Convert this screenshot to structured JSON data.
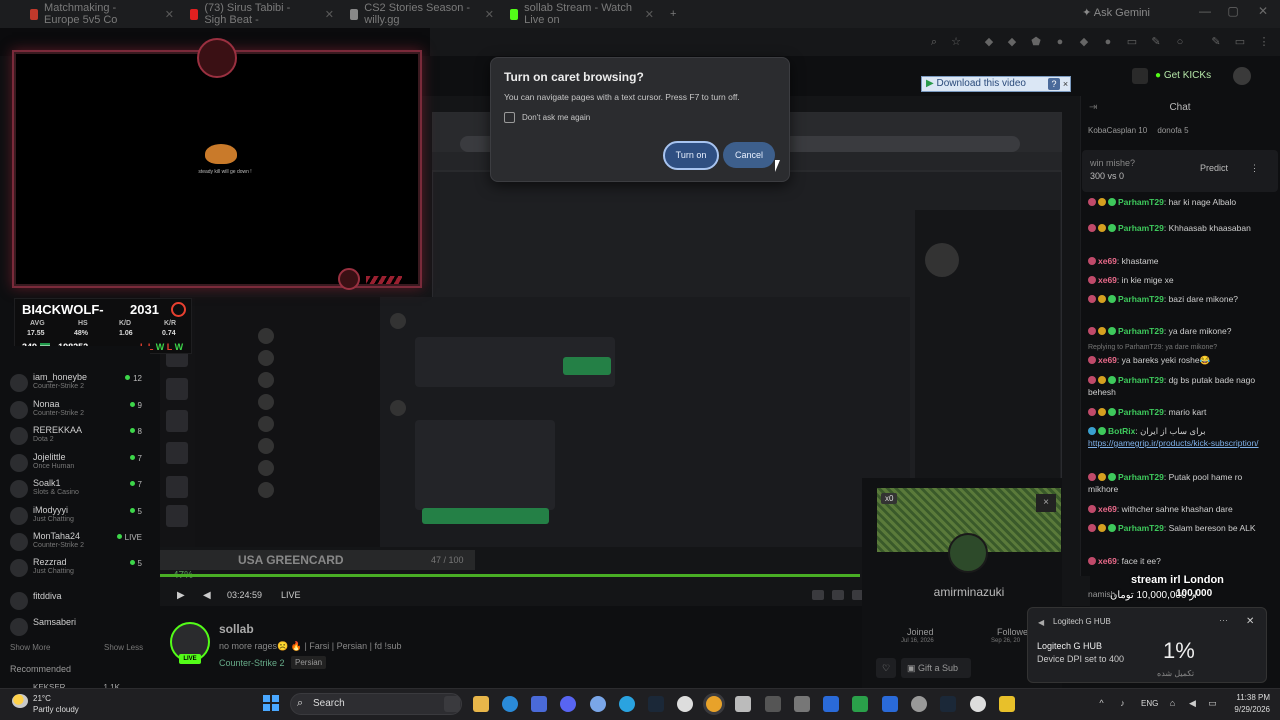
{
  "browser": {
    "tabs": [
      {
        "label": "Matchmaking - Europe 5v5 Co",
        "color": "#c0392b"
      },
      {
        "label": "(73) Sirus Tabibi - Sigh Beat -",
        "color": "#e02020"
      },
      {
        "label": "CS2 Stories Season - willy.gg",
        "color": "#888888"
      },
      {
        "label": "sollab Stream - Watch Live on",
        "color": "#53fc18"
      }
    ],
    "new_tab": "+",
    "ask_gemini": "Ask Gemini"
  },
  "dialog": {
    "title": "Turn on caret browsing?",
    "body": "You can navigate pages with a text cursor. Press F7 to turn off.",
    "checkbox_label": "Don't ask me again",
    "confirm": "Turn on",
    "cancel": "Cancel"
  },
  "download_bar": {
    "label": "Download this video",
    "help": "?",
    "close": "×"
  },
  "kick_header": {
    "get_kicks": "Get KICKs"
  },
  "stats_overlay": {
    "name": "BI4CKWOLF-",
    "elo": "2031",
    "headers": [
      "AVG",
      "HS",
      "K/D",
      "K/R"
    ],
    "values": [
      "17.55",
      "48%",
      "1.06",
      "0.74"
    ],
    "matches": "349",
    "points": "198252",
    "results": [
      "L",
      "L",
      "W",
      "L",
      "W"
    ]
  },
  "webcam": {
    "caption": "steady kill will ge down !"
  },
  "sidebar": {
    "channels": [
      {
        "name": "iam_honeybe",
        "game": "Counter-Strike 2",
        "viewers": "12"
      },
      {
        "name": "Nonaa",
        "game": "Counter-Strike 2",
        "viewers": "9"
      },
      {
        "name": "REREKKAA",
        "game": "Dota 2",
        "viewers": "8"
      },
      {
        "name": "Jojelittle",
        "game": "Once Human",
        "viewers": "7"
      },
      {
        "name": "Soalk1",
        "game": "Slots & Casino",
        "viewers": "7"
      },
      {
        "name": "iModyyyi",
        "game": "Just Chatting",
        "viewers": "5"
      },
      {
        "name": "MonTaha24",
        "game": "Counter-Strike 2",
        "viewers": "LIVE"
      },
      {
        "name": "Rezzrad",
        "game": "Just Chatting",
        "viewers": "5"
      },
      {
        "name": "fitddiva",
        "game": "",
        "viewers": ""
      },
      {
        "name": "Samsaberi",
        "game": "",
        "viewers": ""
      }
    ],
    "show_more": "Show More",
    "show_less": "Show Less",
    "recommended": "Recommended",
    "partial_item": "KEKSER",
    "partial_count": "1.1K"
  },
  "player": {
    "overlay_title": "USA GREENCARD",
    "overlay_count": "47 / 100",
    "overlay_pct": "47%",
    "progress": 1.0,
    "time": "03:24:59",
    "live": "LIVE"
  },
  "stream": {
    "streamer": "sollab",
    "title": "no more rages☹️ 🔥 | Farsi | Persian | fd !sub",
    "category": "Counter-Strike 2",
    "language": "Persian",
    "live_badge": "LIVE"
  },
  "sub_card": {
    "x_label": "x0",
    "name": "amirminazuki",
    "joined_label": "Joined",
    "joined_date": "Jul 16, 2026",
    "follow_label": "Followe",
    "follow_date": "Sep 26, 20",
    "gift": "Gift a Sub",
    "close": "×"
  },
  "chat": {
    "title": "Chat",
    "users": [
      "KobaCasplan 10",
      "donofa 5"
    ],
    "prediction_q": "win mishe?",
    "prediction_odds": "300 vs 0",
    "predict": "Predict",
    "messages": [
      {
        "user": "ParhamT29",
        "color": "#3ec95c",
        "text": "har ki nage Albalo"
      },
      {
        "user": "ParhamT29",
        "color": "#3ec95c",
        "text": "Khhaasab khaasaban"
      },
      {
        "user": "xe69",
        "color": "#e86a8a",
        "text": "khastame"
      },
      {
        "user": "xe69",
        "color": "#e86a8a",
        "text": "in kie mige xe"
      },
      {
        "user": "ParhamT29",
        "color": "#3ec95c",
        "text": "bazi dare mikone?"
      },
      {
        "user": "ParhamT29",
        "color": "#3ec95c",
        "text": "ya dare mikone?"
      },
      {
        "user": "",
        "color": "#777777",
        "text": "Replying to ParhamT29: ya dare mikone?"
      },
      {
        "user": "xe69",
        "color": "#e86a8a",
        "text": "ya bareks yeki roshe😂"
      },
      {
        "user": "ParhamT29",
        "color": "#3ec95c",
        "text": "dg bs putak bade nago behesh"
      },
      {
        "user": "ParhamT29",
        "color": "#3ec95c",
        "text": "mario kart"
      },
      {
        "user": "BotRix",
        "color": "#3ec95c",
        "text": "برای ساب از ایران",
        "link": "https://gamegrip.ir/products/kick-subscription/"
      },
      {
        "user": "ParhamT29",
        "color": "#3ec95c",
        "text": "Putak pool hame ro mikhore"
      },
      {
        "user": "xe69",
        "color": "#e86a8a",
        "text": "withcher sahne khashan dare"
      },
      {
        "user": "ParhamT29",
        "color": "#3ec95c",
        "text": "Salam bereson be ALK"
      },
      {
        "user": "xe69",
        "color": "#e86a8a",
        "text": "face it ee?"
      },
      {
        "user": "",
        "color": "#777777",
        "text": "namish"
      }
    ]
  },
  "irl_overlay": {
    "title": "stream irl London",
    "amount_right": "100,000",
    "amount_left": "از 10,000,000 تومان"
  },
  "toast": {
    "app": "Logitech G HUB",
    "title": "Logitech G HUB",
    "body": "Device DPI set to 400",
    "percent": "1%",
    "sub": "تکمیل شده",
    "more": "···",
    "close": "✕"
  },
  "taskbar": {
    "temp": "21°C",
    "weather": "Partly cloudy",
    "search": "Search",
    "lang": "ENG",
    "time": "11:38 PM",
    "date": "9/29/2026"
  }
}
